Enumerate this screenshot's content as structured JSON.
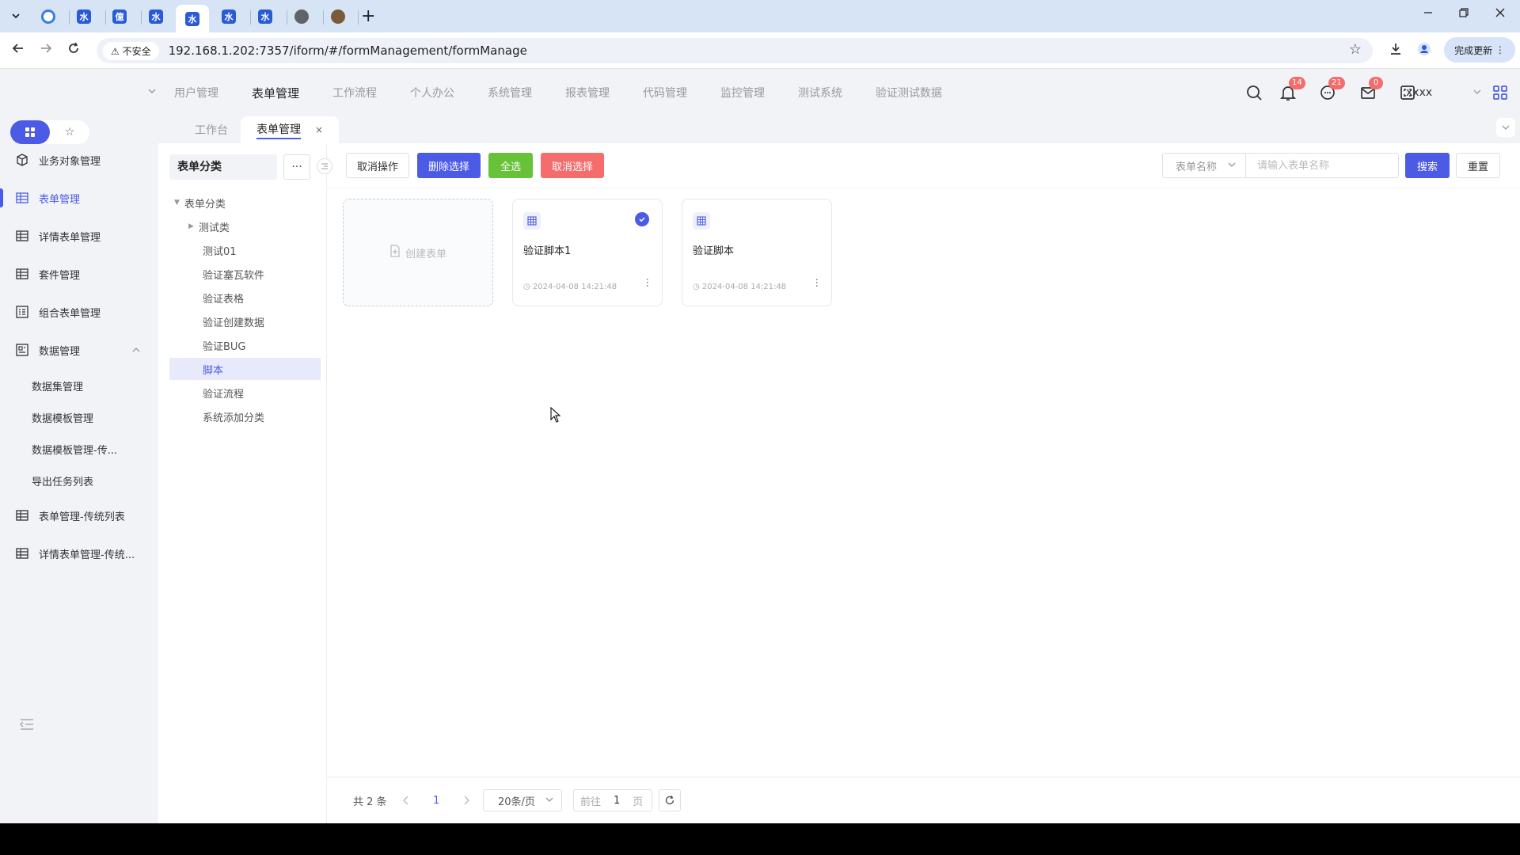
{
  "browser": {
    "tabs": [
      {
        "icon": "ring",
        "glyph": ""
      },
      {
        "icon": "app",
        "glyph": "水"
      },
      {
        "icon": "app",
        "glyph": "億"
      },
      {
        "icon": "app",
        "glyph": "水"
      },
      {
        "icon": "app",
        "glyph": "水",
        "active": true
      },
      {
        "icon": "app",
        "glyph": "水"
      },
      {
        "icon": "app",
        "glyph": "水"
      },
      {
        "icon": "globe",
        "glyph": ""
      },
      {
        "icon": "user",
        "glyph": ""
      }
    ],
    "insecure_label": "不安全",
    "url": "192.168.1.202:7357/iform/#/formManagement/formManage",
    "update_label": "完成更新"
  },
  "topnav": {
    "menu": [
      "用户管理",
      "表单管理",
      "工作流程",
      "个人办公",
      "系统管理",
      "报表管理",
      "代码管理",
      "监控管理",
      "测试系统",
      "验证测试数据"
    ],
    "active_index": 1,
    "badges": {
      "notifications": "14",
      "messages": "21",
      "mail": "0"
    },
    "user": "xxxx"
  },
  "sidebar": {
    "items": [
      {
        "label": "业务对象管理",
        "icon": "cube-icon"
      },
      {
        "label": "表单管理",
        "icon": "table-icon",
        "active": true
      },
      {
        "label": "详情表单管理",
        "icon": "table-icon"
      },
      {
        "label": "套件管理",
        "icon": "table-icon"
      },
      {
        "label": "组合表单管理",
        "icon": "list-form-icon"
      },
      {
        "label": "数据管理",
        "icon": "data-icon",
        "expanded": true
      }
    ],
    "sub_items": [
      "数据集管理",
      "数据模板管理",
      "数据模板管理-传...",
      "导出任务列表"
    ],
    "items_after": [
      {
        "label": "表单管理-传统列表",
        "icon": "table-icon"
      },
      {
        "label": "详情表单管理-传统...",
        "icon": "table-icon"
      }
    ]
  },
  "pagetabs": {
    "workbench": "工作台",
    "active": "表单管理"
  },
  "tree": {
    "header": "表单分类",
    "more": "···",
    "root": "表单分类",
    "children": [
      {
        "label": "测试类",
        "has_children": true
      },
      {
        "label": "测试01"
      },
      {
        "label": "验证塞瓦软件"
      },
      {
        "label": "验证表格"
      },
      {
        "label": "验证创建数据"
      },
      {
        "label": "验证BUG"
      },
      {
        "label": "脚本",
        "selected": true
      },
      {
        "label": "验证流程"
      },
      {
        "label": "系统添加分类"
      }
    ]
  },
  "toolbar": {
    "cancel_op": "取消操作",
    "delete_selected": "删除选择",
    "select_all": "全选",
    "cancel_selection": "取消选择",
    "search_field": "表单名称",
    "search_placeholder": "请输入表单名称",
    "search": "搜索",
    "reset": "重置"
  },
  "cards": {
    "create_label": "创建表单",
    "items": [
      {
        "name": "验证脚本1",
        "time": "2024-04-08 14:21:48",
        "checked": true
      },
      {
        "name": "验证脚本",
        "time": "2024-04-08 14:21:48",
        "checked": false
      }
    ]
  },
  "pager": {
    "total": "共 2 条",
    "current_page": "1",
    "page_size": "20条/页",
    "goto_prefix": "前往",
    "goto_value": "1",
    "goto_suffix": "页"
  },
  "colors": {
    "primary": "#4c5be6",
    "success": "#67c23a",
    "danger": "#f56c6c"
  }
}
